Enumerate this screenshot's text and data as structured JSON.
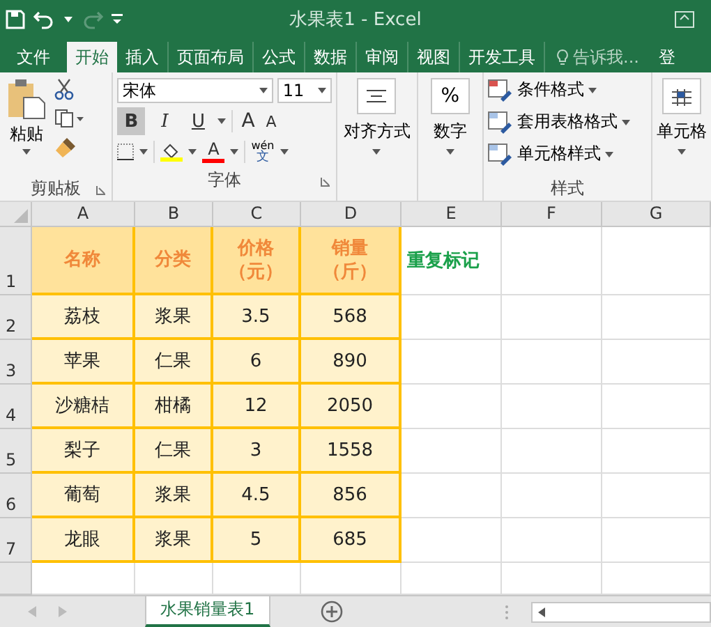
{
  "title_bar": {
    "title": "水果表1 - Excel"
  },
  "tabs": [
    {
      "label": "文件",
      "selected": false
    },
    {
      "label": "开始",
      "selected": true
    },
    {
      "label": "插入",
      "selected": false
    },
    {
      "label": "页面布局",
      "selected": false
    },
    {
      "label": "公式",
      "selected": false
    },
    {
      "label": "数据",
      "selected": false
    },
    {
      "label": "审阅",
      "selected": false
    },
    {
      "label": "视图",
      "selected": false
    },
    {
      "label": "开发工具",
      "selected": false
    }
  ],
  "tell_me": "告诉我...",
  "sign_in": "登",
  "ribbon": {
    "clipboard": {
      "paste": "粘贴",
      "label": "剪贴板"
    },
    "font": {
      "name": "宋体",
      "size": "11",
      "buttons": [
        {
          "label": "B",
          "pressed": true,
          "kind": "bold"
        },
        {
          "label": "I",
          "pressed": false,
          "kind": "italic"
        },
        {
          "label": "U",
          "pressed": false,
          "kind": "underline"
        }
      ],
      "grow": "A",
      "shrink": "A",
      "font_color_letter": "A",
      "phonetic_top": "wén",
      "phonetic_bottom": "文",
      "label": "字体"
    },
    "alignment": {
      "label": "对齐方式"
    },
    "number": {
      "symbol": "%",
      "label": "数字"
    },
    "styles": {
      "items": [
        "条件格式",
        "套用表格格式",
        "单元格样式"
      ],
      "label": "样式"
    },
    "cells": {
      "label": "单元格"
    }
  },
  "sheet": {
    "columns": [
      "A",
      "B",
      "C",
      "D",
      "E",
      "F",
      "G"
    ],
    "row_numbers": [
      "1",
      "2",
      "3",
      "4",
      "5",
      "6",
      "7"
    ],
    "header": [
      [
        "名称"
      ],
      [
        "分类"
      ],
      [
        "价格",
        "（元）"
      ],
      [
        "销量",
        "（斤）"
      ]
    ],
    "note": "重复标记",
    "rows": [
      [
        "荔枝",
        "浆果",
        "3.5",
        "568"
      ],
      [
        "苹果",
        "仁果",
        "6",
        "890"
      ],
      [
        "沙糖桔",
        "柑橘",
        "12",
        "2050"
      ],
      [
        "梨子",
        "仁果",
        "3",
        "1558"
      ],
      [
        "葡萄",
        "浆果",
        "4.5",
        "856"
      ],
      [
        "龙眼",
        "浆果",
        "5",
        "685"
      ]
    ]
  },
  "sheet_tabs": [
    {
      "label": "水果销量表1",
      "selected": true
    }
  ]
}
